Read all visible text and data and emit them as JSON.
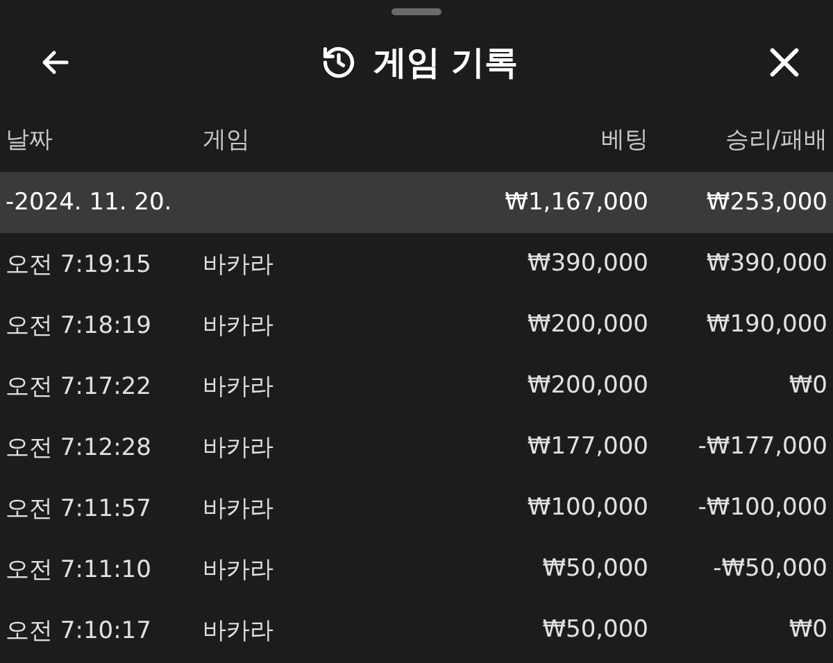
{
  "header": {
    "title": "게임 기록"
  },
  "table": {
    "columns": [
      "날짜",
      "게임",
      "베팅",
      "승리/패배"
    ],
    "summary": {
      "date": "-2024. 11. 20.",
      "bet": "₩1,167,000",
      "result": "₩253,000"
    },
    "rows": [
      {
        "time": "오전 7:19:15",
        "game": "바카라",
        "bet": "₩390,000",
        "result": "₩390,000"
      },
      {
        "time": "오전 7:18:19",
        "game": "바카라",
        "bet": "₩200,000",
        "result": "₩190,000"
      },
      {
        "time": "오전 7:17:22",
        "game": "바카라",
        "bet": "₩200,000",
        "result": "₩0"
      },
      {
        "time": "오전 7:12:28",
        "game": "바카라",
        "bet": "₩177,000",
        "result": "-₩177,000"
      },
      {
        "time": "오전 7:11:57",
        "game": "바카라",
        "bet": "₩100,000",
        "result": "-₩100,000"
      },
      {
        "time": "오전 7:11:10",
        "game": "바카라",
        "bet": "₩50,000",
        "result": "-₩50,000"
      },
      {
        "time": "오전 7:10:17",
        "game": "바카라",
        "bet": "₩50,000",
        "result": "₩0"
      }
    ]
  }
}
